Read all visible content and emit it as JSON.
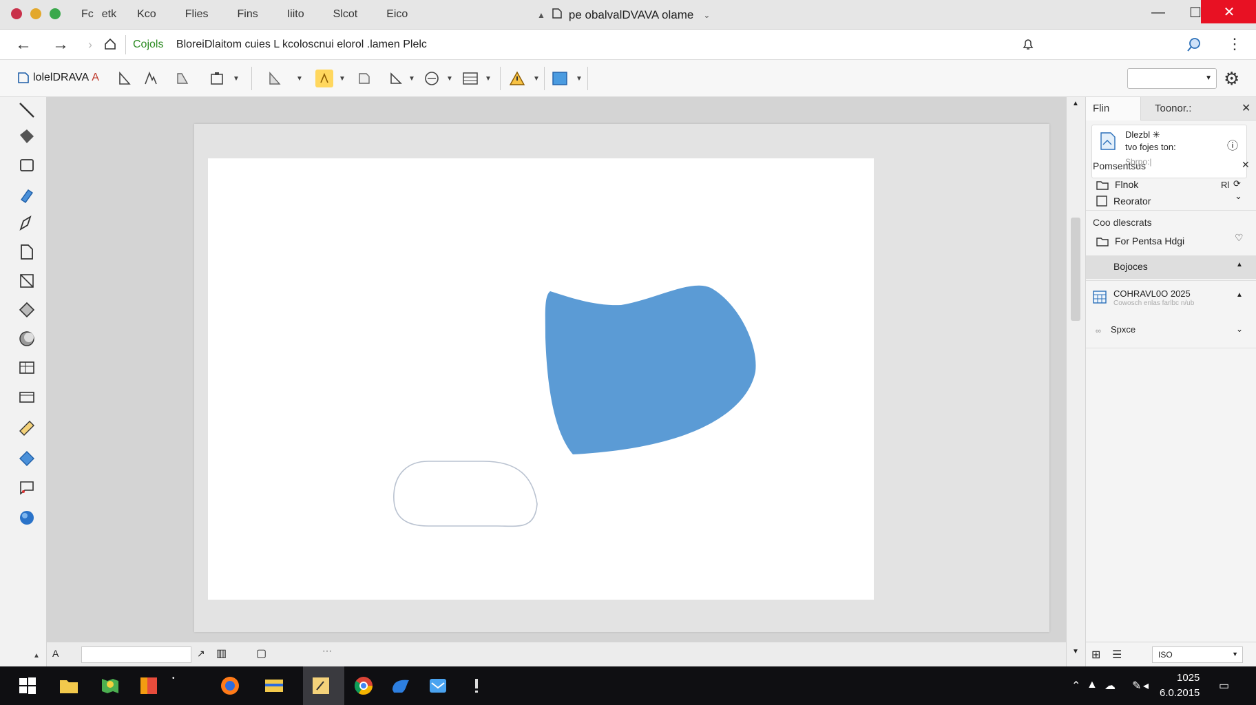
{
  "titlebar": {
    "menu": [
      "Fc",
      "etk",
      "Kco",
      "Flies",
      "Fins",
      "Iiito",
      "Slcot",
      "Eico"
    ],
    "doc_title": "pe obalvalDVAVA olame"
  },
  "address": {
    "url_green": "Cojols",
    "url_text": "BloreiDlaitom cuies   L kcoloscnui elorol .lamen Plelc"
  },
  "toolbar": {
    "app_name": "lolelDRAVA"
  },
  "docker": {
    "tabs": [
      "Flin",
      "Toonor.:"
    ],
    "card": {
      "line1": "Dlezbl ✳",
      "line2": "tvo fojes ton:",
      "placeholder": "Sbrpo:|"
    },
    "section1": {
      "title": "Pomsentsus",
      "rows": [
        "Flnok",
        "Reorator"
      ],
      "extra": "Rl"
    },
    "section2": {
      "title": "Coo dlescrats",
      "row": "For Pentsa Hdgi"
    },
    "highlight": "Bojoces",
    "item": {
      "title": "COHRAVL0O 2025",
      "subtitle": "Cowosch enlas farlbc n/ub"
    },
    "space": "Spxce",
    "bottom_select": "ISO"
  },
  "taskbar": {
    "time": "1025",
    "date": "6.0.2015"
  },
  "colors": {
    "shape_fill": "#5b9bd5",
    "accent": "#e81123",
    "green": "#2c8a22"
  }
}
